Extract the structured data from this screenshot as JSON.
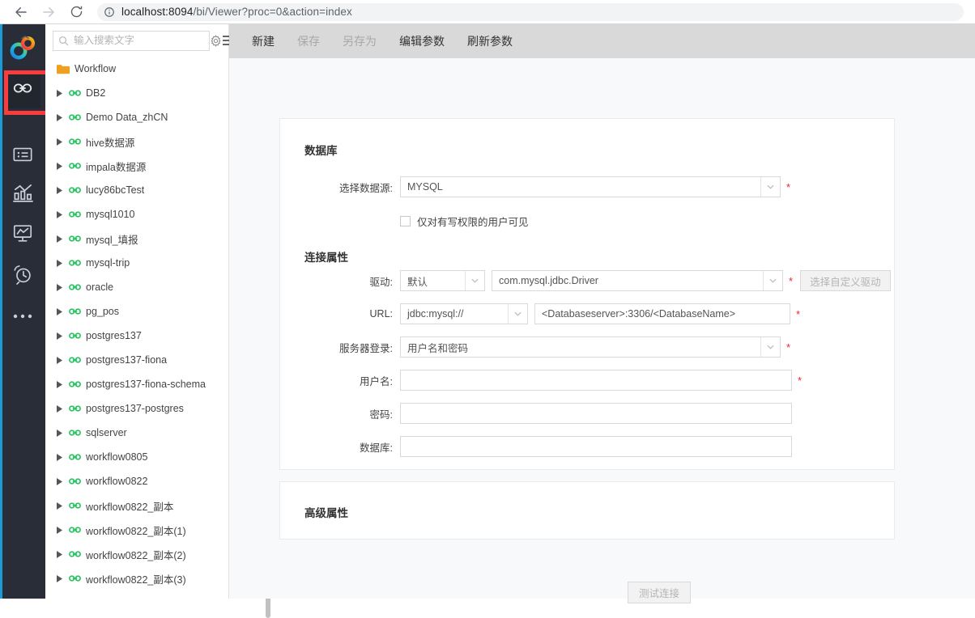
{
  "browser": {
    "url_host": "localhost:8094",
    "url_path": "/bi/Viewer?proc=0&action=index",
    "back_icon": "back-arrow-icon",
    "forward_icon": "forward-arrow-icon",
    "reload_icon": "reload-icon",
    "info_icon": "info-circle-icon"
  },
  "rail": {
    "logo_name": "app-logo",
    "items": [
      {
        "icon": "link-icon",
        "name": "rail-item-datasource",
        "active": true
      },
      {
        "icon": "list-card-icon",
        "name": "rail-item-dataset",
        "active": false
      },
      {
        "icon": "bar-chart-icon",
        "name": "rail-item-analysis",
        "active": false
      },
      {
        "icon": "dashboard-icon",
        "name": "rail-item-dashboard",
        "active": false
      },
      {
        "icon": "alarm-clock-icon",
        "name": "rail-item-schedule",
        "active": false
      },
      {
        "icon": "ellipsis-icon",
        "name": "rail-item-more",
        "active": false
      }
    ],
    "highlight_color": "#fa3c3c"
  },
  "tree": {
    "search_placeholder": "输入搜索文字",
    "search_value": "",
    "search_icon": "search-icon",
    "settings_icon": "gear-icon",
    "menu_icon": "menu-icon",
    "root": {
      "label": "Workflow",
      "icon": "folder-icon"
    },
    "items": [
      {
        "label": "DB2"
      },
      {
        "label": "Demo Data_zhCN"
      },
      {
        "label": "hive数据源"
      },
      {
        "label": "impala数据源"
      },
      {
        "label": "lucy86bcTest"
      },
      {
        "label": "mysql1010"
      },
      {
        "label": "mysql_填报"
      },
      {
        "label": "mysql-trip"
      },
      {
        "label": "oracle"
      },
      {
        "label": "pg_pos"
      },
      {
        "label": "postgres137"
      },
      {
        "label": "postgres137-fiona"
      },
      {
        "label": "postgres137-fiona-schema"
      },
      {
        "label": "postgres137-postgres"
      },
      {
        "label": "sqlserver"
      },
      {
        "label": "workflow0805"
      },
      {
        "label": "workflow0822"
      },
      {
        "label": "workflow0822_副本"
      },
      {
        "label": "workflow0822_副本(1)"
      },
      {
        "label": "workflow0822_副本(2)"
      },
      {
        "label": "workflow0822_副本(3)"
      }
    ],
    "node_icon": "link-icon",
    "caret_icon": "caret-right-icon",
    "node_icon_color": "#22c35e"
  },
  "toolbar": {
    "items": [
      {
        "label": "新建",
        "disabled": false
      },
      {
        "label": "保存",
        "disabled": true
      },
      {
        "label": "另存为",
        "disabled": true
      },
      {
        "label": "编辑参数",
        "disabled": false
      },
      {
        "label": "刷新参数",
        "disabled": false
      }
    ]
  },
  "form": {
    "db_section_title": "数据库",
    "conn_section_title": "连接属性",
    "adv_section_title": "高级属性",
    "datasource": {
      "label": "选择数据源:",
      "value": "MYSQL",
      "required": "*"
    },
    "write_only_checkbox": {
      "label": "仅对有写权限的用户可见",
      "checked": false
    },
    "driver": {
      "label": "驱动:",
      "mode_value": "默认",
      "class_value": "com.mysql.jdbc.Driver",
      "required": "*",
      "custom_button": "选择自定义驱动"
    },
    "url": {
      "label": "URL:",
      "scheme_value": "jdbc:mysql://",
      "host_value": "<Databaseserver>:3306/<DatabaseName>",
      "required": "*"
    },
    "server_login": {
      "label": "服务器登录:",
      "value": "用户名和密码",
      "required": "*"
    },
    "username": {
      "label": "用户名:",
      "value": "",
      "required": "*"
    },
    "password": {
      "label": "密码:",
      "value": ""
    },
    "database": {
      "label": "数据库:",
      "value": ""
    },
    "test_button": "测试连接"
  }
}
